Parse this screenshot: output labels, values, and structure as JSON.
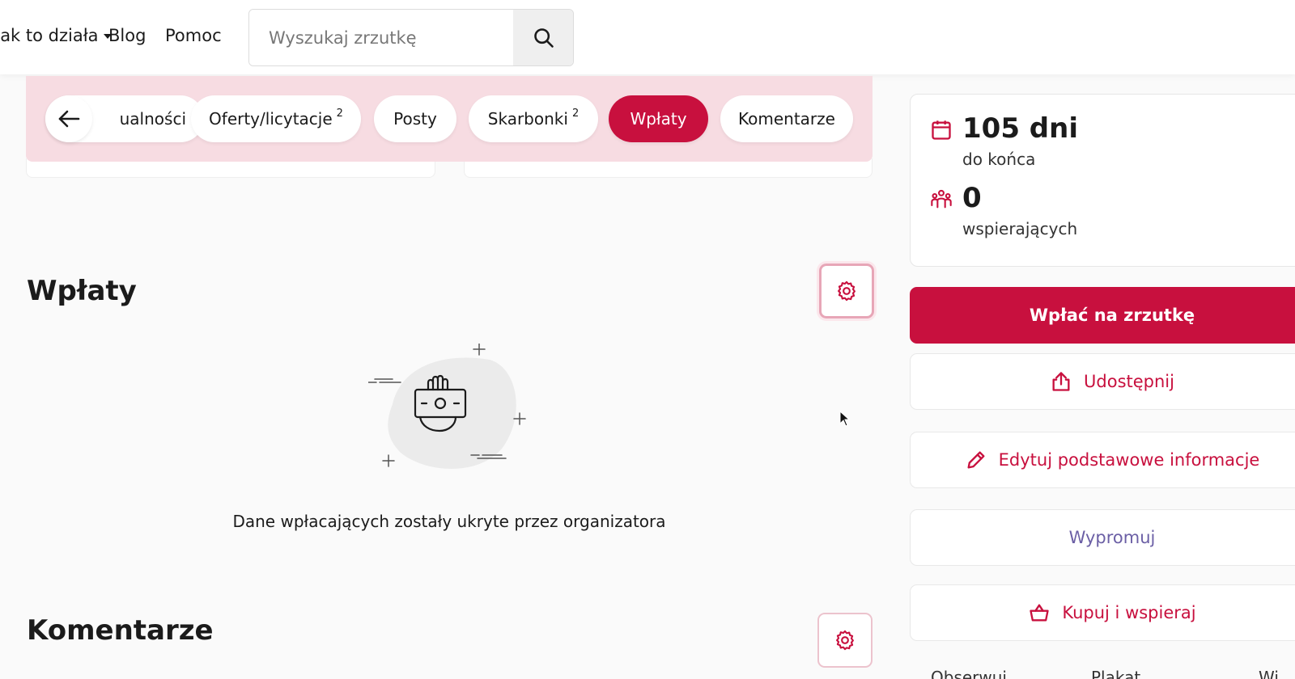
{
  "nav": {
    "how_it_works": "Jak to działa",
    "blog": "Blog",
    "help": "Pomoc"
  },
  "search": {
    "placeholder": "Wyszukaj zrzutkę",
    "icon": "search-icon"
  },
  "tabs": [
    {
      "label": "Aktualności",
      "badge": ""
    },
    {
      "label": "Oferty/licytacje",
      "badge": "2"
    },
    {
      "label": "Posty",
      "badge": ""
    },
    {
      "label": "Skarbonki",
      "badge": "2"
    },
    {
      "label": "Wpłaty",
      "badge": "",
      "active": true
    },
    {
      "label": "Komentarze",
      "badge": ""
    }
  ],
  "payments": {
    "title": "Wpłaty",
    "empty_message": "Dane wpłacających zostały ukryte przez organizatora"
  },
  "comments": {
    "title": "Komentarze"
  },
  "stats": {
    "days_value": "105 dni",
    "days_label": "do końca",
    "supporters_value": "0",
    "supporters_label": "wspierających"
  },
  "actions": {
    "donate": "Wpłać na zrzutkę",
    "share": "Udostępnij",
    "edit": "Edytuj podstawowe informacje",
    "promote": "Wypromuj",
    "shop": "Kupuj i wspieraj"
  },
  "footer_peek": {
    "observe": "Obserwuj",
    "poster": "Plakat",
    "more": "Wi"
  },
  "colors": {
    "accent": "#c8103e",
    "tab_strip_bg": "#f7dce2",
    "promo_text": "#6b5fa5"
  }
}
